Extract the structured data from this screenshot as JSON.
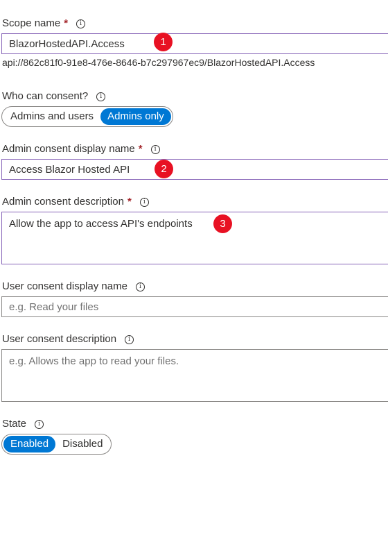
{
  "scope_name": {
    "label": "Scope name",
    "required_mark": "*",
    "value": "BlazorHostedAPI.Access",
    "badge": "1",
    "uri": "api://862c81f0-91e8-476e-8646-b7c297967ec9/BlazorHostedAPI.Access"
  },
  "who_can_consent": {
    "label": "Who can consent?",
    "options": [
      "Admins and users",
      "Admins only"
    ],
    "selected": "Admins only"
  },
  "admin_display_name": {
    "label": "Admin consent display name",
    "required_mark": "*",
    "value": "Access Blazor Hosted API",
    "badge": "2"
  },
  "admin_description": {
    "label": "Admin consent description",
    "required_mark": "*",
    "value": "Allow the app to access API's endpoints",
    "badge": "3"
  },
  "user_display_name": {
    "label": "User consent display name",
    "placeholder": "e.g. Read your files"
  },
  "user_description": {
    "label": "User consent description",
    "placeholder": "e.g. Allows the app to read your files."
  },
  "state": {
    "label": "State",
    "options": [
      "Enabled",
      "Disabled"
    ],
    "selected": "Enabled"
  },
  "info_icon_glyph": "i",
  "colors": {
    "accent": "#0078d4",
    "focus_border": "#8764b8",
    "required": "#a4262c",
    "badge": "#e81123"
  }
}
